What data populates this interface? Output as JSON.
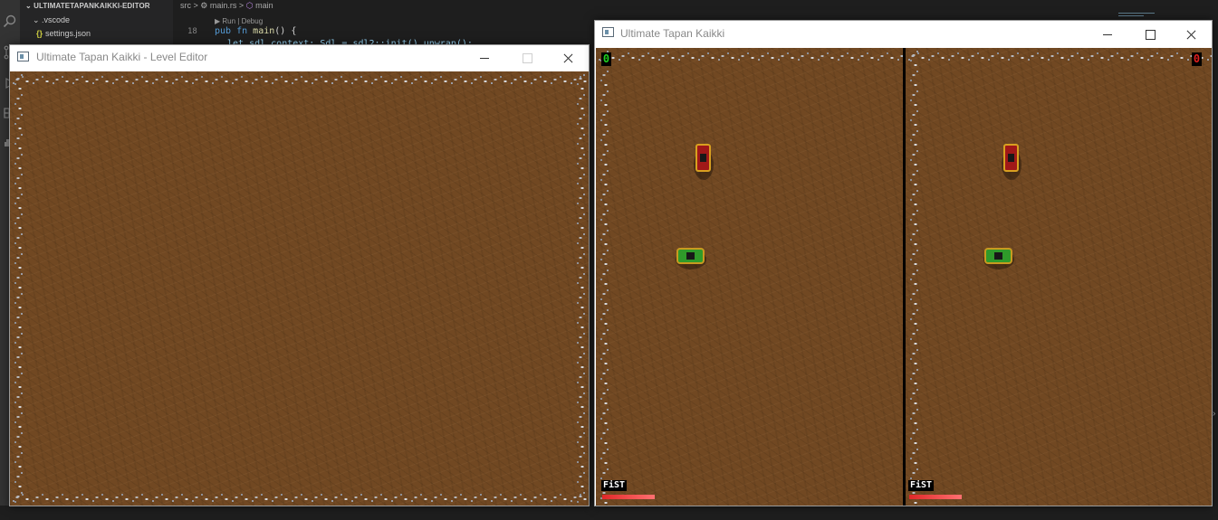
{
  "vscode": {
    "explorer": {
      "root_label": "ULTIMATETAPANKAIKKI-EDITOR",
      "folder_label": ".vscode",
      "file_badge": "{}",
      "file_label": "settings.json"
    },
    "breadcrumb": {
      "part1": "src",
      "sep1": ">",
      "part2": "main.rs",
      "sep2": ">",
      "part3": "main"
    },
    "codelens": "▶ Run | Debug",
    "line_number": "18",
    "code": {
      "kw_pub": "pub",
      "kw_fn": "fn",
      "fn_name": "main",
      "rest": "() {",
      "line2": "let sdl_context: Sdl = sdl2::init().unwrap();"
    },
    "activity_icons": [
      "explorer-icon",
      "search-icon",
      "source-control-icon",
      "extensions-icon",
      "docker-icon"
    ],
    "colors": {
      "activity_bar": "#333333",
      "sidebar": "#252526",
      "editor": "#1e1e1e",
      "keyword": "#569cd6",
      "function": "#dcdcaa"
    }
  },
  "level_editor_window": {
    "title": "Ultimate Tapan Kaikki - Level Editor",
    "maximize_disabled": true
  },
  "game_window": {
    "title": "Ultimate Tapan Kaikki",
    "players": [
      {
        "score": "0",
        "score_color": "#20d020",
        "weapon": "FiST",
        "health": 1.0
      },
      {
        "score": "0",
        "score_color": "#e02020",
        "weapon": "FiST",
        "health": 1.0
      }
    ]
  },
  "theme": {
    "dirt": "#714822",
    "rock": "#b6b8be"
  }
}
